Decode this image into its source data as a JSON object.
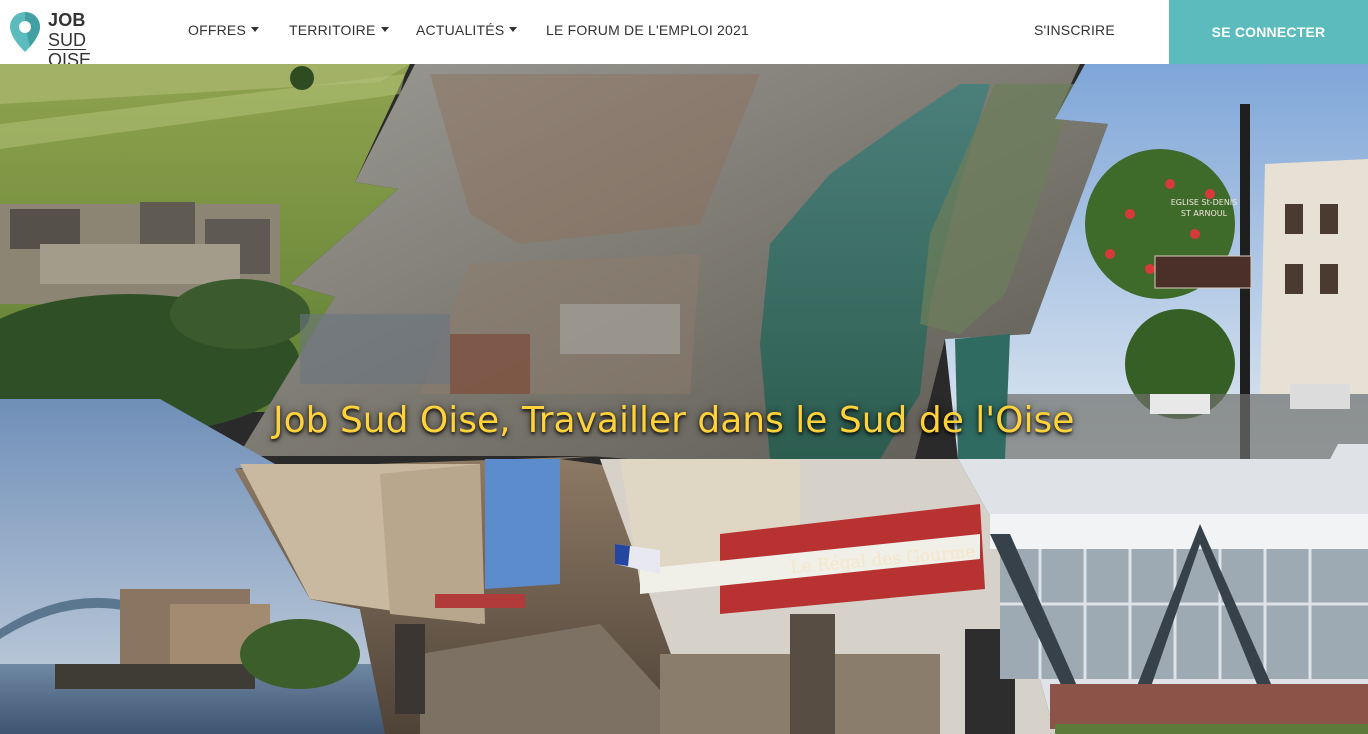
{
  "nav": {
    "logo_line1": "JOB",
    "logo_line2": "SUD OISE",
    "items": [
      {
        "label": "OFFRES",
        "dropdown": true
      },
      {
        "label": "TERRITOIRE",
        "dropdown": true
      },
      {
        "label": "ACTUALITÉS",
        "dropdown": true
      },
      {
        "label": "LE FORUM DE L'EMPLOI 2021",
        "dropdown": false
      }
    ],
    "register": "S'INSCRIRE",
    "login": "SE CONNECTER"
  },
  "hero": {
    "headline": "Job Sud Oise, Travailler dans le Sud de l'Oise",
    "market_sign": "Le Régal des Gourme",
    "street_sign_line1": "EGLISE St-DENIS",
    "street_sign_line2": "ST ARNOUL"
  },
  "colors": {
    "accent": "#5cbcbd",
    "headline": "#ffd23a",
    "nav_text": "#333333"
  }
}
